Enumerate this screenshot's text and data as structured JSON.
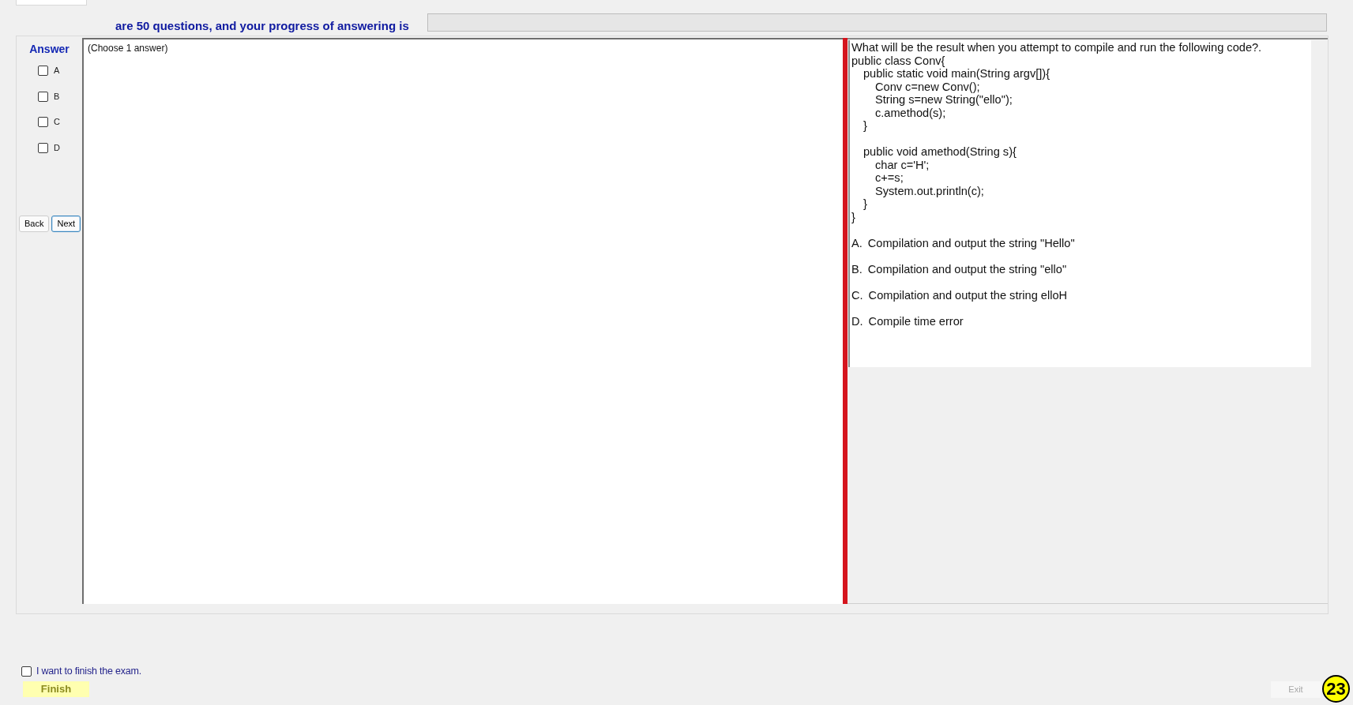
{
  "header": {
    "text": "are 50 questions, and your progress of answering is",
    "progress": {
      "level": 0
    }
  },
  "answer_panel": {
    "title": "Answer",
    "choices": [
      {
        "label": "A",
        "checked": false
      },
      {
        "label": "B",
        "checked": false
      },
      {
        "label": "C",
        "checked": false
      },
      {
        "label": "D",
        "checked": false
      }
    ],
    "nav_buttons": [
      {
        "label": "Back",
        "focused": false
      },
      {
        "label": "Next",
        "focused": true
      }
    ]
  },
  "answer_area": {
    "instruction": "(Choose 1 answer)"
  },
  "question": {
    "prompt": "What will be the result when you attempt to compile and run the following code?.",
    "code": {
      "header": "public class Conv{",
      "members": [
        {
          "header": "public static void main(String argv[]){",
          "body": [
            "Conv c=new Conv();",
            "String s=new String(\"ello\");",
            "c.amethod(s);"
          ],
          "close": "}"
        },
        {
          "header": "public void amethod(String s){",
          "body": [
            "char c='H';",
            "c+=s;",
            "System.out.println(c);"
          ],
          "close": "}"
        }
      ],
      "close": "}"
    },
    "options": [
      {
        "letter": "A.",
        "text": "Compilation and output the string \"Hello\""
      },
      {
        "letter": "B.",
        "text": "Compilation and output the string \"ello\""
      },
      {
        "letter": "C.",
        "text": "Compilation and output the string elloH"
      },
      {
        "letter": "D.",
        "text": "Compile time error"
      }
    ]
  },
  "footer": {
    "confirm": {
      "label": "I want to finish the exam.",
      "checked": false
    },
    "finish_button": {
      "label": "Finish"
    },
    "exit_button": {
      "label": "Exit",
      "disabled": true
    },
    "question_number": "23"
  }
}
